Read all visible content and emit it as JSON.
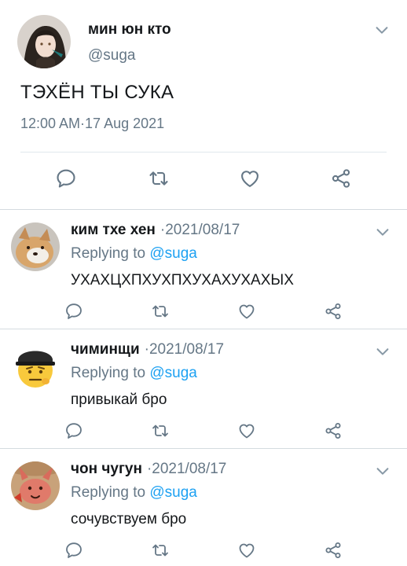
{
  "main_tweet": {
    "name": "мин юн кто",
    "handle": "@suga",
    "text": "ТЭХЁН ТЫ СУКА",
    "time": "12:00 AM·17 Aug 2021"
  },
  "replies": [
    {
      "name": "ким тхе хен",
      "date": "·2021/08/17",
      "replying_prefix": "Replying to ",
      "mention": "@suga",
      "text": "УХАХЦХПХУХПХУХАХУХАХЫХ"
    },
    {
      "name": "чиминщи",
      "date": "·2021/08/17",
      "replying_prefix": "Replying to ",
      "mention": "@suga",
      "text": "привыкай бро"
    },
    {
      "name": "чон чугун",
      "date": "·2021/08/17",
      "replying_prefix": "Replying to ",
      "mention": "@suga",
      "text": "сочувствуем бро"
    }
  ],
  "icons": {
    "reply": "speech-bubble-icon",
    "retweet": "retweet-icon",
    "like": "heart-icon",
    "share": "share-icon",
    "menu": "chevron-down-icon"
  },
  "colors": {
    "text": "#14171a",
    "secondary": "#657786",
    "link": "#1da1f2",
    "icon": "#657786",
    "separator": "#e1e8ed"
  }
}
